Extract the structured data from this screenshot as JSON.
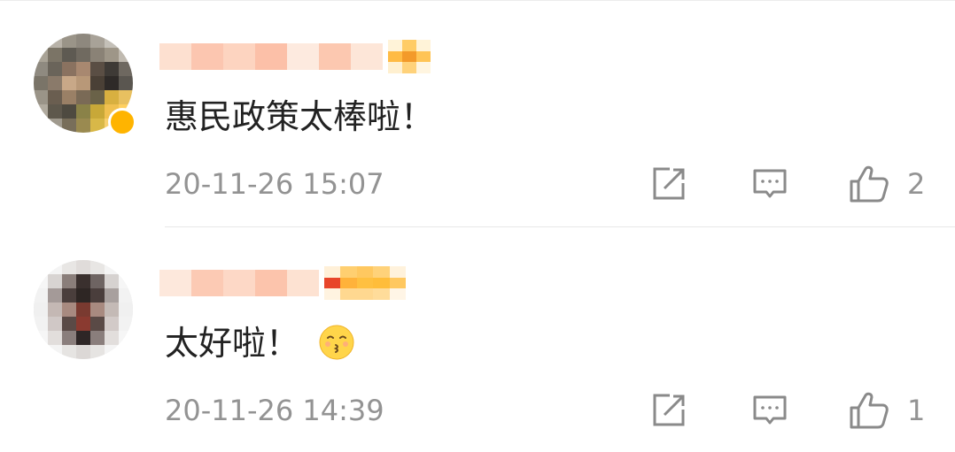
{
  "comments": [
    {
      "text": "惠民政策太棒啦！",
      "time": "20-11-26 15:07",
      "likes": "2",
      "has_vip_badge": true,
      "has_emoji": false
    },
    {
      "text": "太好啦！",
      "time": "20-11-26 14:39",
      "likes": "1",
      "has_vip_badge": false,
      "has_emoji": true,
      "emoji": "kissing-face-icon"
    }
  ],
  "icons": {
    "share": "share-icon",
    "reply": "comment-icon",
    "like": "thumbs-up-icon"
  },
  "colors": {
    "text": "#222222",
    "meta": "#939393",
    "icon": "#8a8a8a",
    "vip": "#ffb400",
    "divider": "#e8e8e8"
  }
}
